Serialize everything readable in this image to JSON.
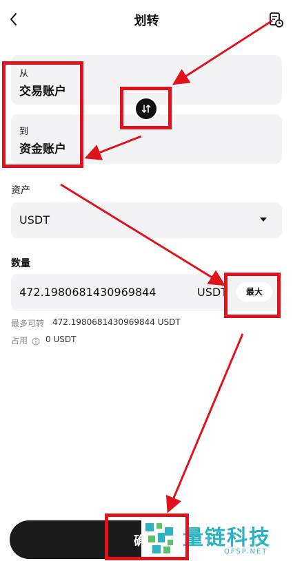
{
  "header": {
    "title": "划转"
  },
  "transfer": {
    "from_label": "从",
    "from_account": "交易账户",
    "to_label": "到",
    "to_account": "资金账户"
  },
  "asset": {
    "label": "资产",
    "value": "USDT"
  },
  "amount": {
    "label": "数量",
    "value": "472.1980681430969844",
    "unit": "USDT",
    "max_label": "最大",
    "available_label": "最多可转",
    "available_value": "472.1980681430969844 USDT",
    "occupied_label": "占用",
    "occupied_value": "0 USDT"
  },
  "footer": {
    "confirm_label": "确"
  },
  "watermark": {
    "brand": "量链科技",
    "url": "QFSP.NET"
  },
  "colors": {
    "annotation_red": "#e0121b",
    "card_bg": "#f3f3f5",
    "button_bg": "#1b1b1b"
  }
}
